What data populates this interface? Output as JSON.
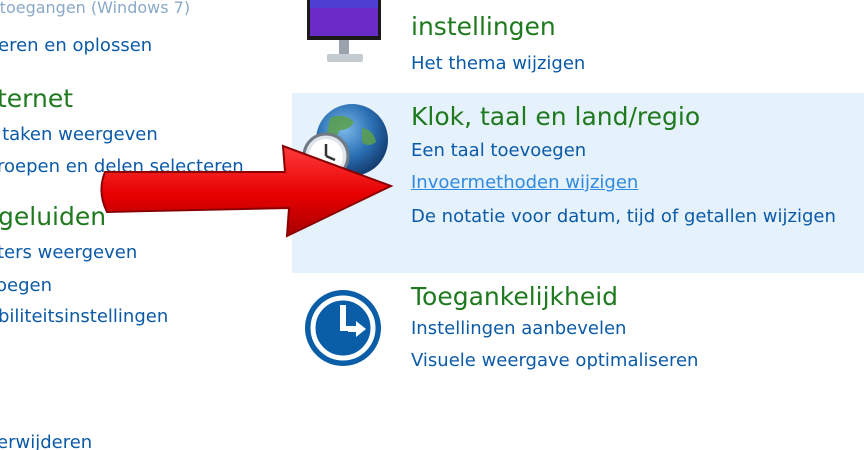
{
  "left_column": {
    "top_partial": "r toegangen (Windows 7)",
    "link1": "eren en oplossen",
    "heading1": "ternet",
    "link2": ":taken weergeven",
    "link3": "roepen en delen selecteren",
    "heading2": "geluiden",
    "link4": "ters weergeven",
    "link5": "oegen",
    "link6": "biliteitsinstellingen",
    "link7": "erwijderen"
  },
  "right_column": {
    "appearance": {
      "title": "instellingen",
      "link1": "Het thema wijzigen"
    },
    "clock": {
      "title": "Klok, taal en land/regio",
      "link1": "Een taal toevoegen",
      "link2": "Invoermethoden wijzigen",
      "link3": "De notatie voor datum, tijd of getallen wijzigen"
    },
    "access": {
      "title": "Toegankelijkheid",
      "link1": "Instellingen aanbevelen",
      "link2": "Visuele weergave optimaliseren"
    }
  },
  "colors": {
    "heading": "#1f7a1f",
    "link": "#0b5aa8",
    "highlight": "#e5f1fb",
    "arrow": "#e60000"
  },
  "icons": [
    "monitor-icon",
    "globe-clock-icon",
    "ease-of-access-icon",
    "red-arrow"
  ]
}
